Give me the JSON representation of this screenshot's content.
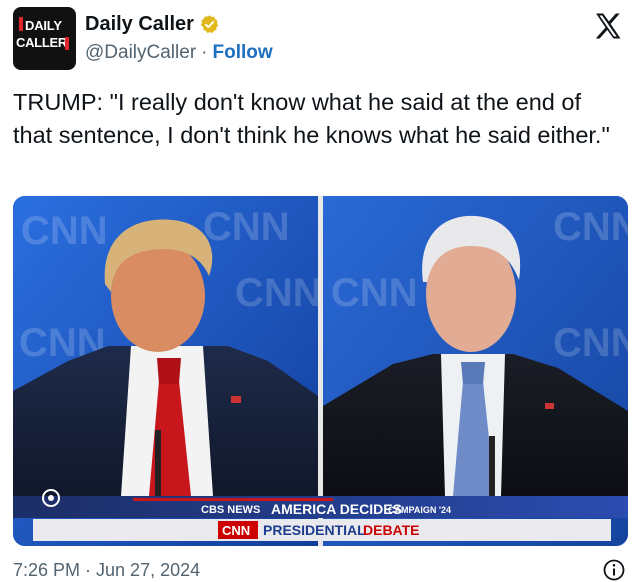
{
  "account": {
    "display_name": "Daily Caller",
    "handle": "@DailyCaller",
    "separator": "·",
    "follow_label": "Follow",
    "avatar_line1": "DAILY",
    "avatar_line2": "CALLER"
  },
  "tweet": {
    "text": "TRUMP: \"I really don't know what he said at the end of that sentence, I don't think he knows what he said either.\"",
    "timestamp": "7:26 PM · Jun 27, 2024"
  },
  "media": {
    "backdrop_logo": "CNN",
    "lower_third": {
      "network": "CBS NEWS",
      "headline": "AMERICA DECIDES",
      "campaign": "CAMPAIGN '24",
      "channel": "CNN",
      "program_word1": "PRESIDENTIAL",
      "program_word2": "DEBATE"
    }
  },
  "icons": {
    "verified": "verified-badge-icon",
    "x_logo": "x-logo-icon",
    "info": "info-icon"
  },
  "colors": {
    "follow_link": "#1d6fbf",
    "verified_gold": "#e2b719",
    "cnn_red": "#cc0000",
    "stage_blue": "#1b57c8"
  }
}
